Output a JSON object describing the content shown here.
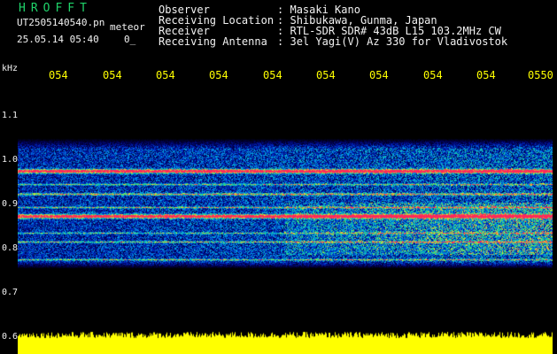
{
  "header": {
    "title": "HROFFT",
    "filename_line1": "UT2505140540.pn",
    "meteor_label": "meteor",
    "datetime": "25.05.14 05:40",
    "counter": "0_"
  },
  "info": [
    {
      "label": "Observer",
      "sep": ":",
      "value": "Masaki Kano"
    },
    {
      "label": "Receiving Location",
      "sep": ":",
      "value": "Shibukawa, Gunma, Japan"
    },
    {
      "label": "Receiver",
      "sep": ":",
      "value": "RTL-SDR SDR# 43dB L15 103.2MHz CW"
    },
    {
      "label": "Receiving Antenna",
      "sep": ":",
      "value": "3el Yagi(V) Az 330 for Vladivostok"
    }
  ],
  "y_axis": {
    "unit": "kHz",
    "ticks": [
      "1.1",
      "1.0",
      "0.9",
      "0.8",
      "0.7",
      "0.6"
    ]
  },
  "x_axis": {
    "ticks": [
      "054",
      "054",
      "054",
      "054",
      "054",
      "054",
      "054",
      "054",
      "054",
      "0550"
    ]
  },
  "colors": {
    "background": "#000000",
    "title_green": "#1fd36a",
    "info_text": "#f2f2f2",
    "tick_yellow": "#ffff00",
    "signal_yellow": "#ffff00",
    "carrier_red": "#ff2a5a"
  }
}
